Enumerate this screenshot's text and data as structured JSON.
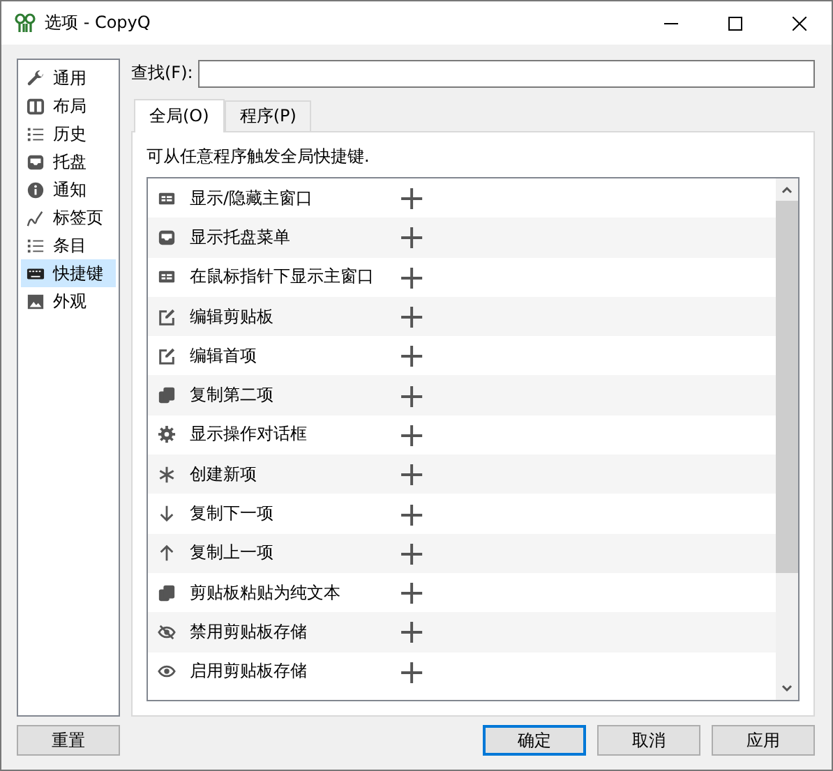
{
  "window": {
    "title": "选项 - CopyQ"
  },
  "sidebar": {
    "items": [
      {
        "label": "通用",
        "selected": false
      },
      {
        "label": "布局",
        "selected": false
      },
      {
        "label": "历史",
        "selected": false
      },
      {
        "label": "托盘",
        "selected": false
      },
      {
        "label": "通知",
        "selected": false
      },
      {
        "label": "标签页",
        "selected": false
      },
      {
        "label": "条目",
        "selected": false
      },
      {
        "label": "快捷键",
        "selected": true
      },
      {
        "label": "外观",
        "selected": false
      }
    ]
  },
  "search": {
    "label": "查找(F):"
  },
  "tabs": [
    {
      "label": "全局(O)",
      "selected": true
    },
    {
      "label": "程序(P)",
      "selected": false
    }
  ],
  "description": "可从任意程序触发全局快捷键.",
  "shortcuts": [
    {
      "name": "显示/隐藏主窗口",
      "add": "+"
    },
    {
      "name": "显示托盘菜单",
      "add": "+"
    },
    {
      "name": "在鼠标指针下显示主窗口",
      "add": "+"
    },
    {
      "name": "编辑剪贴板",
      "add": "+"
    },
    {
      "name": "编辑首项",
      "add": "+"
    },
    {
      "name": "复制第二项",
      "add": "+"
    },
    {
      "name": "显示操作对话框",
      "add": "+"
    },
    {
      "name": "创建新项",
      "add": "+"
    },
    {
      "name": "复制下一项",
      "add": "+"
    },
    {
      "name": "复制上一项",
      "add": "+"
    },
    {
      "name": "剪贴板粘贴为纯文本",
      "add": "+"
    },
    {
      "name": "禁用剪贴板存储",
      "add": "+"
    },
    {
      "name": "启用剪贴板存储",
      "add": "+"
    }
  ],
  "buttons": {
    "reset": "重置",
    "ok": "确定",
    "cancel": "取消",
    "apply": "应用"
  }
}
